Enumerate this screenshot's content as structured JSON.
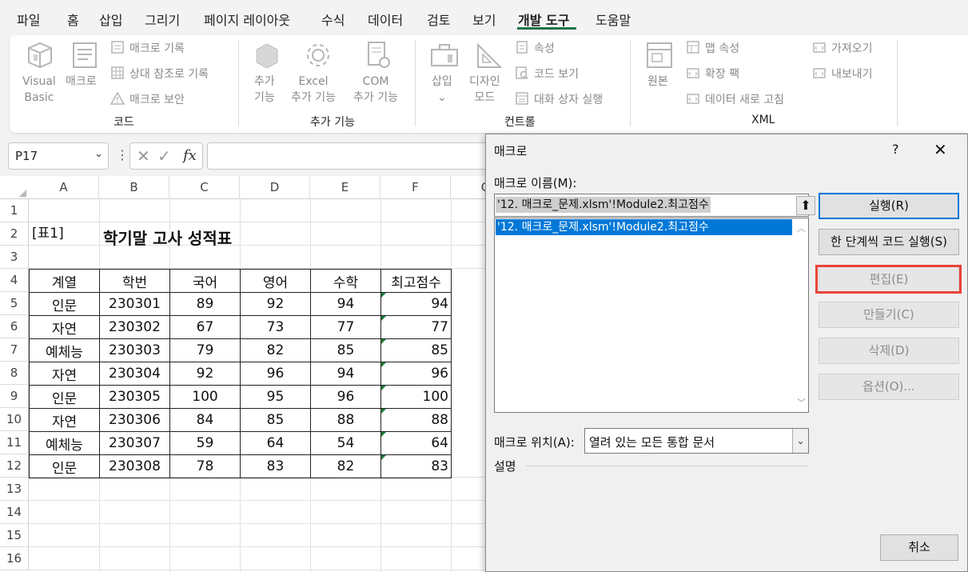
{
  "menu": {
    "items": [
      "파일",
      "홈",
      "삽입",
      "그리기",
      "페이지 레이아웃",
      "수식",
      "데이터",
      "검토",
      "보기",
      "개발 도구",
      "도움말"
    ],
    "active": "개발 도구"
  },
  "ribbon": {
    "code": {
      "visual_basic": [
        "Visual",
        "Basic"
      ],
      "macro": "매크로",
      "record_macro": "매크로 기록",
      "relative_ref": "상대 참조로 기록",
      "macro_security": "매크로 보안",
      "group_label": "코드"
    },
    "addins": {
      "addins": [
        "추가",
        "기능"
      ],
      "excel_addins": [
        "Excel",
        "추가 기능"
      ],
      "com_addins": [
        "COM",
        "추가 기능"
      ],
      "group_label": "추가 기능"
    },
    "controls": {
      "insert": "삽입",
      "design_mode": [
        "디자인",
        "모드"
      ],
      "properties": "속성",
      "view_code": "코드 보기",
      "run_dialog": "대화 상자 실행",
      "group_label": "컨트롤"
    },
    "xml": {
      "source": "원본",
      "map_properties": "맵 속성",
      "expansion_packs": "확장 팩",
      "refresh_data": "데이터 새로 고침",
      "import": "가져오기",
      "export": "내보내기",
      "group_label": "XML"
    }
  },
  "formula_bar": {
    "name_box": "P17",
    "fx": "fx",
    "value": ""
  },
  "sheet": {
    "columns": [
      "A",
      "B",
      "C",
      "D",
      "E",
      "F",
      "G"
    ],
    "rows": [
      "1",
      "2",
      "3",
      "4",
      "5",
      "6",
      "7",
      "8",
      "9",
      "10",
      "11",
      "12",
      "13",
      "14",
      "15",
      "16"
    ],
    "label_a2": "[표1]",
    "title": "학기말 고사 성적표",
    "table": {
      "headers": [
        "계열",
        "학번",
        "국어",
        "영어",
        "수학",
        "최고점수"
      ],
      "rows": [
        [
          "인문",
          "230301",
          "89",
          "92",
          "94",
          "94"
        ],
        [
          "자연",
          "230302",
          "67",
          "73",
          "77",
          "77"
        ],
        [
          "예체능",
          "230303",
          "79",
          "82",
          "85",
          "85"
        ],
        [
          "자연",
          "230304",
          "92",
          "96",
          "94",
          "96"
        ],
        [
          "인문",
          "230305",
          "100",
          "95",
          "96",
          "100"
        ],
        [
          "자연",
          "230306",
          "84",
          "85",
          "88",
          "88"
        ],
        [
          "예체능",
          "230307",
          "59",
          "64",
          "54",
          "64"
        ],
        [
          "인문",
          "230308",
          "78",
          "83",
          "82",
          "83"
        ]
      ]
    }
  },
  "dialog": {
    "title": "매크로",
    "help": "?",
    "close": "✕",
    "name_label": "매크로 이름(M):",
    "name_value": "'12. 매크로_문제.xlsm'!Module2.최고점수",
    "list_items": [
      "'12. 매크로_문제.xlsm'!Module2.최고점수"
    ],
    "buttons": {
      "run": "실행(R)",
      "step_into": "한 단계씩 코드 실행(S)",
      "edit": "편집(E)",
      "create": "만들기(C)",
      "delete": "삭제(D)",
      "options": "옵션(O)...",
      "cancel": "취소"
    },
    "location_label": "매크로 위치(A):",
    "location_value": "열려 있는 모든 통합 문서",
    "description_label": "설명"
  },
  "colors": {
    "accent": "#217346",
    "selection": "#0078d7",
    "highlight": "#e8433a"
  }
}
